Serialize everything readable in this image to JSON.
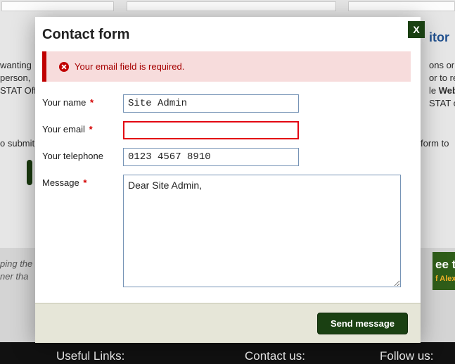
{
  "background": {
    "top_right_link": "itor",
    "left_block": "wanting\nperson,\nSTAT Offi",
    "left_block2": "o submit",
    "right_block_lines": [
      "ons or in",
      "or to req",
      "le Webs",
      "STAT o"
    ],
    "right_form_to": "form to",
    "green_right_top": "ee t",
    "green_right_sub": "f Alexa",
    "quote": "ping the\nner tha",
    "footer_links": "Useful Links:",
    "footer_contact": "Contact us:",
    "footer_follow": "Follow us:"
  },
  "modal": {
    "title": "Contact form",
    "close_label": "X",
    "error_message": "Your email field is required.",
    "labels": {
      "name": "Your name",
      "email": "Your email",
      "telephone": "Your telephone",
      "message": "Message"
    },
    "required_marker": "*",
    "values": {
      "name": "Site Admin",
      "email": "",
      "telephone": "0123 4567 8910",
      "message": "Dear Site Admin,"
    },
    "send_label": "Send message"
  }
}
